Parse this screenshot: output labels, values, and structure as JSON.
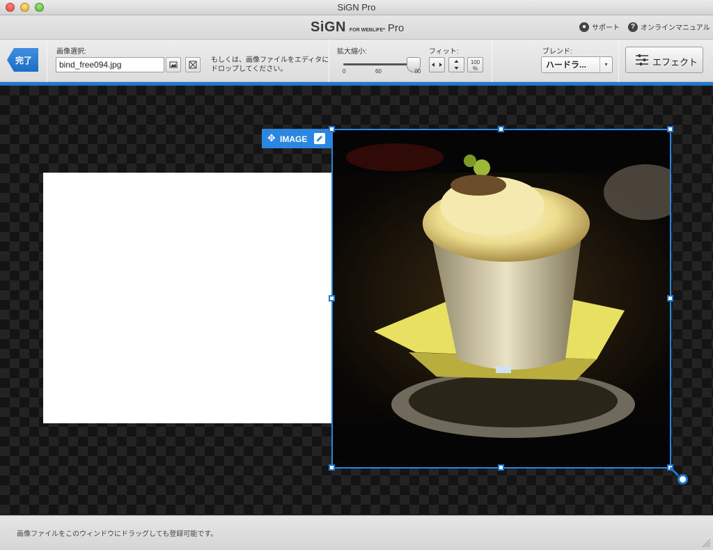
{
  "window": {
    "title": "SiGN Pro"
  },
  "brand": {
    "name": "SiGN",
    "sub": "FOR WEBLIFE*",
    "edition": "Pro"
  },
  "header_links": {
    "support": "サポート",
    "manual": "オンラインマニュアル"
  },
  "toolbar": {
    "done_label": "完了",
    "image_select_label": "画像選択:",
    "file_value": "bind_free094.jpg",
    "hint_line1": "もしくは、画像ファイルをエディタに",
    "hint_line2": "ドロップしてください。",
    "zoom_label": "拡大縮小:",
    "zoom_ticks": {
      "min": "0",
      "mid": "60",
      "max": "100"
    },
    "zoom_level_fraction": 0.95,
    "fit_label": "フィット:",
    "fit_100": "100",
    "fit_pct": "%",
    "blend_label": "ブレンド:",
    "blend_value": "ハードラ...",
    "effect_label": "エフェクト"
  },
  "canvas": {
    "image_tag_label": "IMAGE"
  },
  "status": {
    "message": "画像ファイルをこのウィンドウにドラッグしても登録可能です。"
  },
  "colors": {
    "accent": "#1f78d1",
    "canvas_dark": "#141414",
    "canvas_light": "#232323"
  }
}
